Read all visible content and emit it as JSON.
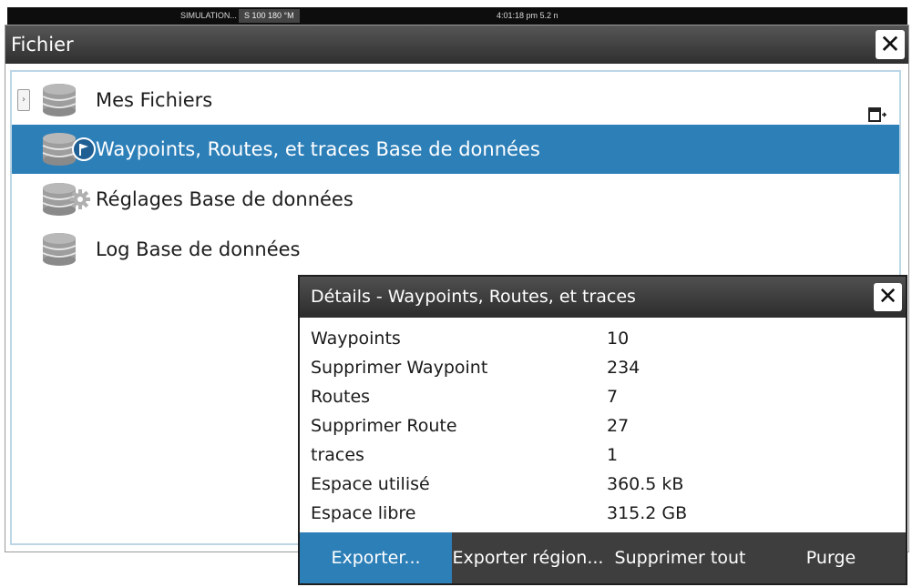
{
  "statusbar": {
    "sim_label": "SIMULATION...",
    "nav_label": "S 100 180 °M",
    "clock": "4:01:18 pm  5.2 n"
  },
  "window": {
    "title": "Fichier",
    "close_label": "✕"
  },
  "files": {
    "items": [
      {
        "label": "Mes Fichiers"
      },
      {
        "label": "Waypoints, Routes, et traces Base de données"
      },
      {
        "label": "Réglages Base de données"
      },
      {
        "label": "Log Base de données"
      }
    ],
    "expander_glyph": "›",
    "selected_index": 1
  },
  "icons": {
    "database": "database-icon",
    "flag_badge": "flag-icon",
    "gear_badge": "gear-icon",
    "export": "export-icon",
    "close": "close-icon"
  },
  "details_dialog": {
    "title": "Détails - Waypoints, Routes, et traces",
    "close_label": "✕",
    "rows": [
      {
        "key": "Waypoints",
        "value": "10"
      },
      {
        "key": "Supprimer Waypoint",
        "value": "234"
      },
      {
        "key": "Routes",
        "value": "7"
      },
      {
        "key": "Supprimer Route",
        "value": "27"
      },
      {
        "key": "traces",
        "value": "1"
      },
      {
        "key": "Espace utilisé",
        "value": "360.5 kB"
      },
      {
        "key": "Espace libre",
        "value": "315.2 GB"
      }
    ],
    "actions": [
      {
        "label": "Exporter..."
      },
      {
        "label": "Exporter région..."
      },
      {
        "label": "Supprimer tout"
      },
      {
        "label": "Purge"
      }
    ]
  },
  "colors": {
    "selection": "#2d7fb8",
    "titlebar": "#3a3a3a",
    "action_bar": "#3e3e3e"
  }
}
